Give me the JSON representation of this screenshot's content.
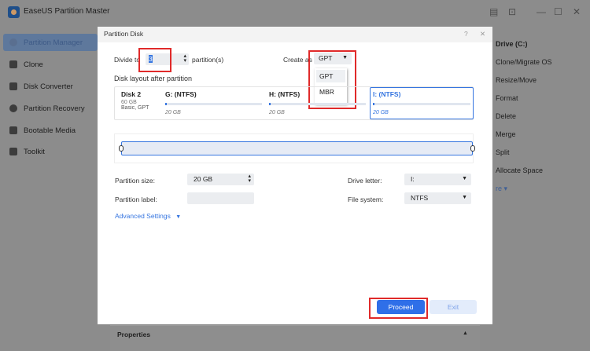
{
  "app": {
    "title": "EaseUS Partition Master"
  },
  "sidebar": {
    "items": [
      {
        "label": "Partition Manager",
        "active": true
      },
      {
        "label": "Clone"
      },
      {
        "label": "Disk Converter"
      },
      {
        "label": "Partition Recovery"
      },
      {
        "label": "Bootable Media"
      },
      {
        "label": "Toolkit"
      }
    ]
  },
  "right_panel": {
    "title": "Drive (C:)",
    "items": [
      "Clone/Migrate OS",
      "Resize/Move",
      "Format",
      "Delete",
      "Merge",
      "Split",
      "Allocate Space"
    ],
    "more": "re"
  },
  "properties": {
    "label": "Properties"
  },
  "dialog": {
    "title": "Partition Disk",
    "help": "?",
    "close": "✕",
    "divide_label": "Divide to",
    "divide_value": "3",
    "partitions_label": "partition(s)",
    "create_as_label": "Create as",
    "create_as_value": "GPT",
    "create_as_options": [
      "GPT",
      "MBR"
    ],
    "layout_label": "Disk layout after partition",
    "disk": {
      "name": "Disk 2",
      "size": "60 GB",
      "type": "Basic, GPT"
    },
    "partitions": [
      {
        "name": "G: (NTFS)",
        "size": "20 GB"
      },
      {
        "name": "H: (NTFS)",
        "size": "20 GB"
      },
      {
        "name": "I: (NTFS)",
        "size": "20 GB",
        "selected": true
      }
    ],
    "partition_size_label": "Partition size:",
    "partition_size_value": "20 GB",
    "partition_label_label": "Partition label:",
    "partition_label_value": "",
    "drive_letter_label": "Drive letter:",
    "drive_letter_value": "I:",
    "file_system_label": "File system:",
    "file_system_value": "NTFS",
    "advanced_label": "Advanced Settings",
    "proceed": "Proceed",
    "exit": "Exit"
  },
  "colors": {
    "accent": "#2f6fe8",
    "highlight": "#e02a2a"
  }
}
